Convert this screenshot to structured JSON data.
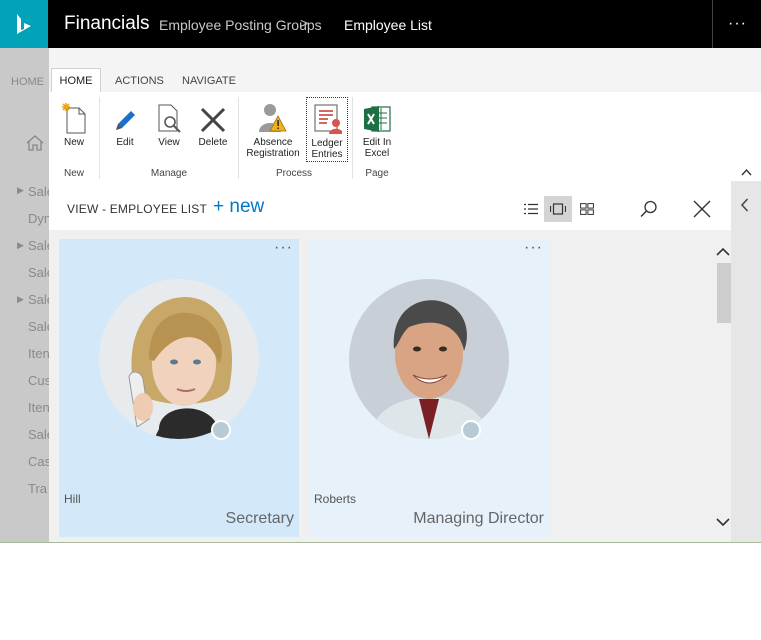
{
  "app": {
    "name": "Financials",
    "breadcrumb": [
      "Employee Posting Groups",
      "Employee List"
    ],
    "breadcrumb_separator": ">",
    "more": "···"
  },
  "background_page": {
    "tab": "HOME",
    "items": [
      "Sale",
      "Dyn",
      "Sale",
      "Sale",
      "Sale",
      "Sale",
      "Iten",
      "Cus",
      "Iten",
      "Sale",
      "Cas",
      "Tra"
    ]
  },
  "ribbon": {
    "tabs": [
      "HOME",
      "ACTIONS",
      "NAVIGATE"
    ],
    "groups": {
      "new": {
        "label": "New",
        "buttons": [
          "New"
        ]
      },
      "manage": {
        "label": "Manage",
        "buttons": [
          "Edit",
          "View",
          "Delete"
        ]
      },
      "process": {
        "label": "Process",
        "buttons": [
          "Absence Registration",
          "Ledger Entries"
        ]
      },
      "page": {
        "label": "Page",
        "buttons": [
          "Edit In Excel"
        ]
      }
    },
    "button_lines": {
      "absence": [
        "Absence",
        "Registration"
      ],
      "ledger": [
        "Ledger",
        "Entries"
      ],
      "excel": [
        "Edit In",
        "Excel"
      ]
    }
  },
  "view": {
    "title": "VIEW - EMPLOYEE LIST",
    "new_label": "+ new"
  },
  "employees": [
    {
      "name": "Hill",
      "job_title": "Secretary",
      "card_color": "#d3e8f8"
    },
    {
      "name": "Roberts",
      "job_title": "Managing Director",
      "card_color": "#e6f1fa"
    }
  ],
  "card_menu": "···",
  "colors": {
    "accent": "#00a3b7",
    "link": "#0078c8",
    "appbar": "#000000"
  },
  "icons": [
    "home-icon",
    "new-icon",
    "edit-icon",
    "view-icon",
    "delete-icon",
    "absence-icon",
    "ledger-icon",
    "excel-icon",
    "list-view-icon",
    "card-view-icon",
    "tile-view-icon",
    "search-icon",
    "close-icon",
    "chevron-left-icon",
    "chevron-up-icon",
    "chevron-down-icon"
  ]
}
